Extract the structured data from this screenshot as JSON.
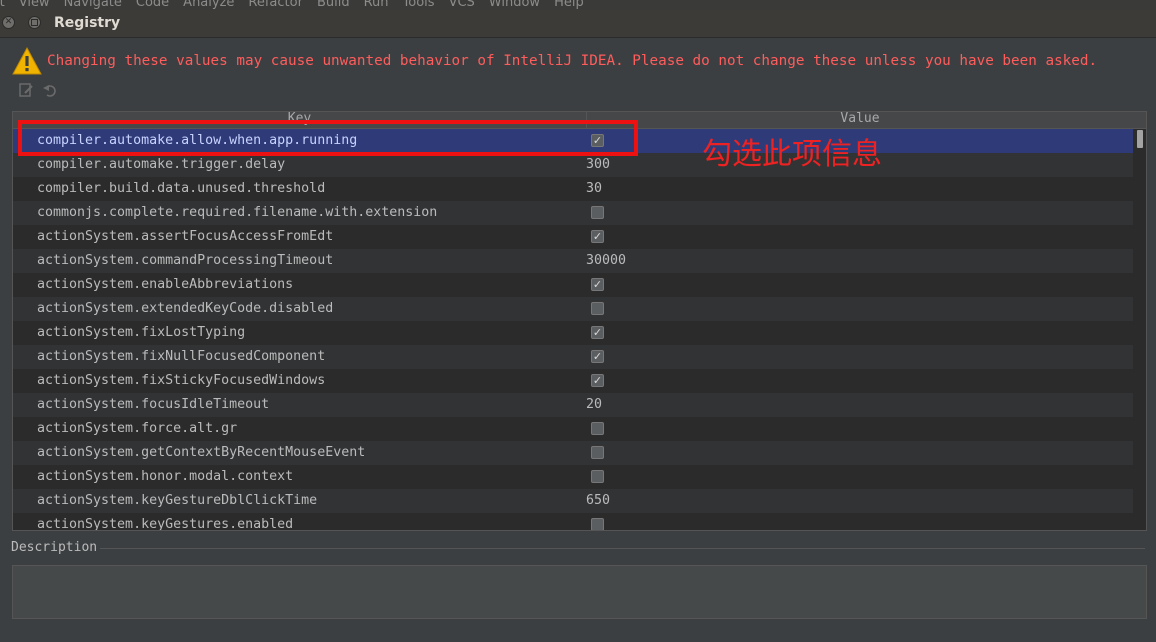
{
  "menubar": {
    "items": [
      "lt",
      "View",
      "Navigate",
      "Code",
      "Analyze",
      "Refactor",
      "Build",
      "Run",
      "Tools",
      "VCS",
      "Window",
      "Help"
    ]
  },
  "window": {
    "title": "Registry"
  },
  "warning": {
    "icon": "warning-triangle-icon",
    "text": "Changing these values may cause unwanted behavior of IntelliJ IDEA. Please do not change these unless you have been asked."
  },
  "toolbar": {
    "icons": [
      "edit-icon",
      "revert-icon"
    ]
  },
  "table": {
    "columns": {
      "key": "Key",
      "value": "Value"
    },
    "rows": [
      {
        "key": "compiler.automake.allow.when.app.running",
        "type": "bool",
        "value": true,
        "selected": true
      },
      {
        "key": "compiler.automake.trigger.delay",
        "type": "text",
        "value": "300"
      },
      {
        "key": "compiler.build.data.unused.threshold",
        "type": "text",
        "value": "30"
      },
      {
        "key": "commonjs.complete.required.filename.with.extension",
        "type": "bool",
        "value": false
      },
      {
        "key": "actionSystem.assertFocusAccessFromEdt",
        "type": "bool",
        "value": true
      },
      {
        "key": "actionSystem.commandProcessingTimeout",
        "type": "text",
        "value": "30000"
      },
      {
        "key": "actionSystem.enableAbbreviations",
        "type": "bool",
        "value": true
      },
      {
        "key": "actionSystem.extendedKeyCode.disabled",
        "type": "bool",
        "value": false
      },
      {
        "key": "actionSystem.fixLostTyping",
        "type": "bool",
        "value": true
      },
      {
        "key": "actionSystem.fixNullFocusedComponent",
        "type": "bool",
        "value": true
      },
      {
        "key": "actionSystem.fixStickyFocusedWindows",
        "type": "bool",
        "value": true
      },
      {
        "key": "actionSystem.focusIdleTimeout",
        "type": "text",
        "value": "20"
      },
      {
        "key": "actionSystem.force.alt.gr",
        "type": "bool",
        "value": false
      },
      {
        "key": "actionSystem.getContextByRecentMouseEvent",
        "type": "bool",
        "value": false
      },
      {
        "key": "actionSystem.honor.modal.context",
        "type": "bool",
        "value": false
      },
      {
        "key": "actionSystem.keyGestureDblClickTime",
        "type": "text",
        "value": "650"
      },
      {
        "key": "actionSystem.keyGestures.enabled",
        "type": "bool",
        "value": false
      }
    ]
  },
  "annotation": {
    "text": "勾选此项信息",
    "color": "#ee2222"
  },
  "description": {
    "label": "Description",
    "text": ""
  },
  "colors": {
    "background": "#3c3f41",
    "selection": "#2f3b79",
    "warning_text": "#ff5c5c",
    "highlight_border": "#ee1111"
  }
}
